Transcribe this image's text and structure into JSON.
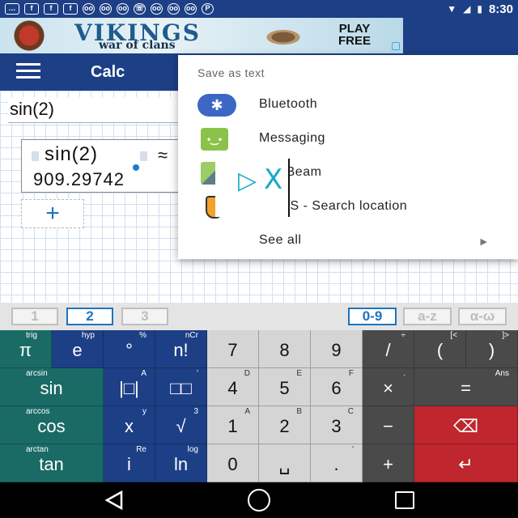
{
  "status_bar": {
    "time": "8:30",
    "icons": [
      "message-icon",
      "facebook-icon",
      "facebook-icon",
      "facebook-icon",
      "voicemail-icon",
      "voicemail-icon",
      "voicemail-icon",
      "whatsapp-icon",
      "voicemail-icon",
      "voicemail-icon",
      "voicemail-icon",
      "pinterest-icon"
    ],
    "icon_labels": [
      "…",
      "f",
      "f",
      "f",
      "oo",
      "oo",
      "oo",
      "☏",
      "oo",
      "oo",
      "oo",
      "P"
    ]
  },
  "ad_banner": {
    "title": "VIKINGS",
    "subtitle": "war of clans",
    "cta": "PLAY\nFREE"
  },
  "app_bar": {
    "title": "Calc"
  },
  "worksheet": {
    "input": "sin(2)",
    "expression": "sin(2)",
    "approx_sign": "≈",
    "result": "909.29742",
    "add_label": "+"
  },
  "share_menu": {
    "title": "Save as text",
    "items": [
      {
        "label": "Bluetooth",
        "icon": "bluetooth-icon"
      },
      {
        "label": "Messaging",
        "icon": "messaging-icon"
      },
      {
        "label": "roid Beam",
        "icon": "android-beam-icon"
      },
      {
        "label": "e GPS - Search location",
        "icon": "gps-icon"
      }
    ],
    "see_all": "See all"
  },
  "page_tabs": {
    "pages": [
      "1",
      "2",
      "3"
    ],
    "active_page": "2",
    "modes": [
      "0-9",
      "a-z",
      "α-ω"
    ],
    "active_mode": "0-9"
  },
  "keypad": {
    "rows": [
      [
        {
          "main": "π",
          "sub": "trig",
          "color": "teal"
        },
        {
          "main": "e",
          "sub": "hyp",
          "color": "blue"
        },
        {
          "main": "°",
          "sub": "%",
          "color": "blue"
        },
        {
          "main": "n!",
          "sub": "nCr",
          "color": "blue"
        },
        {
          "main": "7",
          "sub": "",
          "color": "gray"
        },
        {
          "main": "8",
          "sub": "",
          "color": "gray"
        },
        {
          "main": "9",
          "sub": "",
          "color": "gray"
        },
        {
          "main": "/",
          "sub": "÷",
          "color": "dark"
        },
        {
          "main": "(",
          "sub": "[<",
          "color": "dark"
        },
        {
          "main": ")",
          "sub": "]>",
          "color": "dark"
        }
      ],
      [
        {
          "main": "sin",
          "sub": "arcsin",
          "color": "teal"
        },
        {
          "main": "|□|",
          "sub": "A",
          "color": "blue"
        },
        {
          "main": "□□",
          "sub": "'",
          "color": "blue"
        },
        {
          "main": "4",
          "sub": "D",
          "color": "gray"
        },
        {
          "main": "5",
          "sub": "E",
          "color": "gray"
        },
        {
          "main": "6",
          "sub": "F",
          "color": "gray"
        },
        {
          "main": "×",
          "sub": ".",
          "color": "dark"
        },
        {
          "main": "=",
          "sub": "Ans",
          "color": "dark"
        }
      ],
      [
        {
          "main": "cos",
          "sub": "arccos",
          "color": "teal"
        },
        {
          "main": "x",
          "sub": "y",
          "color": "blue"
        },
        {
          "main": "√",
          "sub": "3",
          "color": "blue"
        },
        {
          "main": "1",
          "sub": "A",
          "color": "gray"
        },
        {
          "main": "2",
          "sub": "B",
          "color": "gray"
        },
        {
          "main": "3",
          "sub": "C",
          "color": "gray"
        },
        {
          "main": "−",
          "sub": "",
          "color": "dark"
        },
        {
          "main": "⌫",
          "sub": "",
          "color": "red"
        }
      ],
      [
        {
          "main": "tan",
          "sub": "arctan",
          "color": "teal"
        },
        {
          "main": "i",
          "sub": "Re",
          "color": "blue"
        },
        {
          "main": "ln",
          "sub": "log",
          "color": "blue"
        },
        {
          "main": "0",
          "sub": "",
          "color": "gray"
        },
        {
          "main": "␣",
          "sub": "",
          "color": "gray"
        },
        {
          "main": ".",
          "sub": "'",
          "color": "gray"
        },
        {
          "main": "+",
          "sub": "",
          "color": "dark"
        },
        {
          "main": "↵",
          "sub": "",
          "color": "red"
        }
      ]
    ]
  },
  "nav_bar": {
    "buttons": [
      "back-icon",
      "home-icon",
      "recent-apps-icon"
    ]
  }
}
